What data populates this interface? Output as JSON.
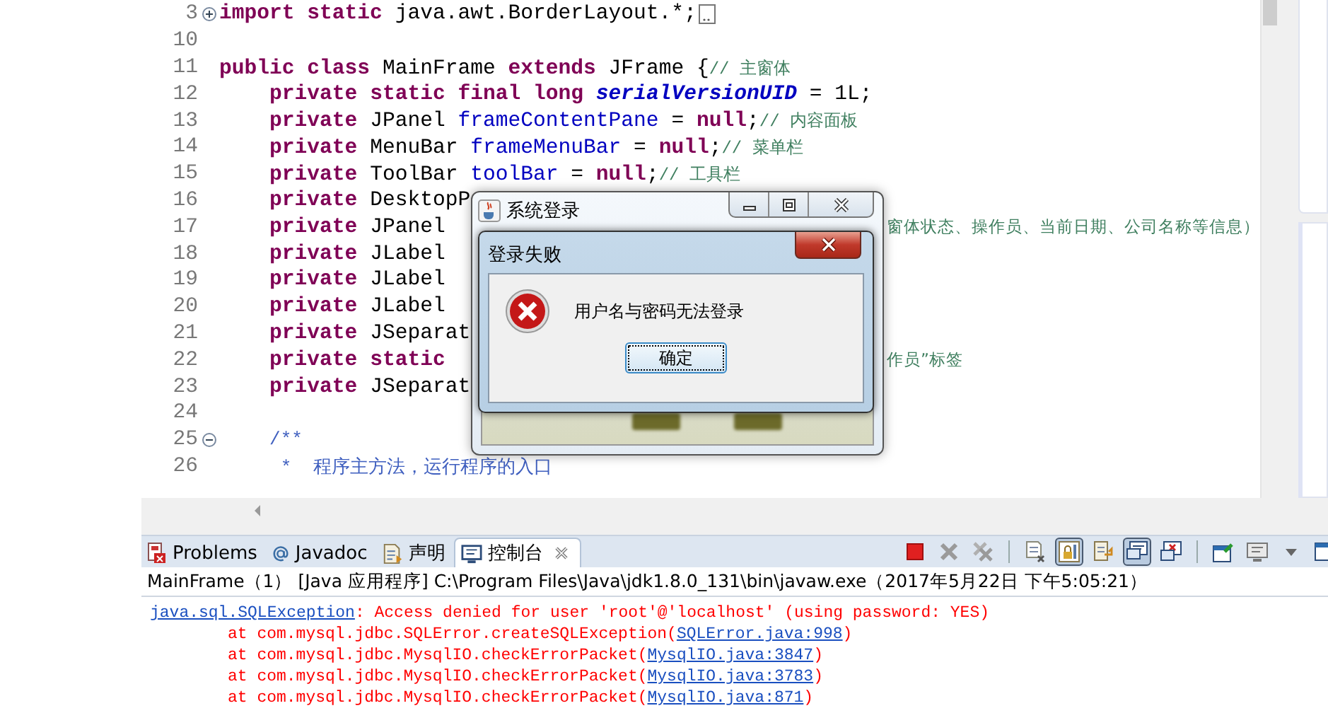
{
  "editor": {
    "lines": [
      {
        "number": "3",
        "kind": "top",
        "expanded": false,
        "folded_marker": true,
        "segments": [
          {
            "kind": "keyword",
            "text": "import"
          },
          {
            "kind": "keyword",
            "text": " static"
          },
          {
            "kind": "plain",
            "text": " java.awt.BorderLayout.*;"
          }
        ]
      },
      {
        "number": "10",
        "kind": "top"
      },
      {
        "number": "11",
        "kind": "top",
        "segments": [
          {
            "kind": "keyword",
            "text": "public"
          },
          {
            "kind": "keyword",
            "text": " class"
          },
          {
            "kind": "plain",
            "text": " MainFrame "
          },
          {
            "kind": "keyword",
            "text": "extends"
          },
          {
            "kind": "plain",
            "text": " JFrame {"
          },
          {
            "kind": "comment",
            "text": "// 主窗体"
          }
        ]
      },
      {
        "number": "12",
        "kind": "member",
        "segments": [
          {
            "kind": "keyword",
            "text": "private"
          },
          {
            "kind": "keyword",
            "text": " static"
          },
          {
            "kind": "keyword",
            "text": " final"
          },
          {
            "kind": "keyword",
            "text": " long"
          },
          {
            "kind": "static-field",
            "text": " serialVersionUID"
          },
          {
            "kind": "plain",
            "text": " = 1L;"
          }
        ]
      },
      {
        "number": "13",
        "kind": "member",
        "segments": [
          {
            "kind": "keyword",
            "text": "private"
          },
          {
            "kind": "plain",
            "text": " JPanel "
          },
          {
            "kind": "field",
            "text": "frameContentPane"
          },
          {
            "kind": "plain",
            "text": " = "
          },
          {
            "kind": "keyword",
            "text": "null"
          },
          {
            "kind": "plain",
            "text": ";"
          },
          {
            "kind": "comment",
            "text": "// 内容面板"
          }
        ]
      },
      {
        "number": "14",
        "kind": "member",
        "segments": [
          {
            "kind": "keyword",
            "text": "private"
          },
          {
            "kind": "plain",
            "text": " MenuBar "
          },
          {
            "kind": "field",
            "text": "frameMenuBar"
          },
          {
            "kind": "plain",
            "text": " = "
          },
          {
            "kind": "keyword",
            "text": "null"
          },
          {
            "kind": "plain",
            "text": ";"
          },
          {
            "kind": "comment",
            "text": "// 菜单栏"
          }
        ]
      },
      {
        "number": "15",
        "kind": "member",
        "segments": [
          {
            "kind": "keyword",
            "text": "private"
          },
          {
            "kind": "plain",
            "text": " ToolBar "
          },
          {
            "kind": "field",
            "text": "toolBar"
          },
          {
            "kind": "plain",
            "text": " = "
          },
          {
            "kind": "keyword",
            "text": "null"
          },
          {
            "kind": "plain",
            "text": ";"
          },
          {
            "kind": "comment",
            "text": "// 工具栏"
          }
        ]
      },
      {
        "number": "16",
        "kind": "member",
        "segments": [
          {
            "kind": "keyword",
            "text": "private"
          },
          {
            "kind": "plain",
            "text": " DesktopP"
          }
        ]
      },
      {
        "number": "17",
        "kind": "member",
        "segments": [
          {
            "kind": "keyword",
            "text": "private"
          },
          {
            "kind": "plain",
            "text": " JPanel"
          }
        ],
        "tail": "窗体状态、操作员、当前日期、公司名称等信息）"
      },
      {
        "number": "18",
        "kind": "member",
        "segments": [
          {
            "kind": "keyword",
            "text": "private"
          },
          {
            "kind": "plain",
            "text": " JLabel"
          }
        ]
      },
      {
        "number": "19",
        "kind": "member",
        "segments": [
          {
            "kind": "keyword",
            "text": "private"
          },
          {
            "kind": "plain",
            "text": " JLabel"
          }
        ]
      },
      {
        "number": "20",
        "kind": "member",
        "segments": [
          {
            "kind": "keyword",
            "text": "private"
          },
          {
            "kind": "plain",
            "text": " JLabel"
          }
        ]
      },
      {
        "number": "21",
        "kind": "member",
        "segments": [
          {
            "kind": "keyword",
            "text": "private"
          },
          {
            "kind": "plain",
            "text": " JSeparat"
          }
        ]
      },
      {
        "number": "22",
        "kind": "member",
        "segments": [
          {
            "kind": "keyword",
            "text": "private"
          },
          {
            "kind": "keyword",
            "text": " static"
          }
        ],
        "tail": "作员”标签"
      },
      {
        "number": "23",
        "kind": "member",
        "segments": [
          {
            "kind": "keyword",
            "text": "private"
          },
          {
            "kind": "plain",
            "text": " JSeparat"
          }
        ]
      },
      {
        "number": "24",
        "kind": "top"
      },
      {
        "number": "25",
        "kind": "member",
        "expanded": true,
        "segments": [
          {
            "kind": "javadoc",
            "text": "/**"
          }
        ]
      },
      {
        "number": "26",
        "kind": "member",
        "segments": [
          {
            "kind": "javadoc",
            "text": " *  程序主方法，运行程序的入口"
          }
        ]
      }
    ]
  },
  "login_window": {
    "title": "系统登录"
  },
  "error_dialog": {
    "title": "登录失败",
    "message": "用户名与密码无法登录",
    "button": "确定"
  },
  "console": {
    "tabs": [
      {
        "label": "Problems",
        "kind": "problems",
        "selected": false,
        "closable": false
      },
      {
        "label": "Javadoc",
        "kind": "javadoc",
        "selected": false,
        "closable": false
      },
      {
        "label": "声明",
        "kind": "declaration",
        "selected": false,
        "closable": false
      },
      {
        "label": "控制台",
        "kind": "console",
        "selected": true,
        "closable": true
      }
    ],
    "toolbar": [
      {
        "kind": "stop",
        "pressed": false
      },
      {
        "kind": "remove",
        "pressed": false
      },
      {
        "kind": "remove-all",
        "pressed": false
      },
      {
        "kind": "separator"
      },
      {
        "kind": "clear",
        "pressed": false
      },
      {
        "kind": "scroll-lock",
        "pressed": true
      },
      {
        "kind": "word-wrap",
        "pressed": false
      },
      {
        "kind": "show-stdout",
        "pressed": true
      },
      {
        "kind": "show-stderr",
        "pressed": false
      },
      {
        "kind": "separator"
      },
      {
        "kind": "pin",
        "pressed": false
      },
      {
        "kind": "display",
        "pressed": false
      },
      {
        "kind": "caret",
        "pressed": false
      },
      {
        "kind": "new-console",
        "pressed": false
      }
    ],
    "header": "MainFrame（1） [Java 应用程序] C:\\Program Files\\Java\\jdk1.8.0_131\\bin\\javaw.exe（2017年5月22日 下午5:05:21）",
    "lines": [
      {
        "kind": "exception",
        "segments": [
          {
            "kind": "link",
            "text": "java.sql.SQLException"
          },
          {
            "kind": "error",
            "text": ": Access denied for user 'root'@'localhost' (using password: YES)"
          }
        ]
      },
      {
        "kind": "frame",
        "segments": [
          {
            "kind": "error",
            "text": "at com.mysql.jdbc.SQLError.createSQLException("
          },
          {
            "kind": "link",
            "text": "SQLError.java:998"
          },
          {
            "kind": "error",
            "text": ")"
          }
        ]
      },
      {
        "kind": "frame",
        "segments": [
          {
            "kind": "error",
            "text": "at com.mysql.jdbc.MysqlIO.checkErrorPacket("
          },
          {
            "kind": "link",
            "text": "MysqlIO.java:3847"
          },
          {
            "kind": "error",
            "text": ")"
          }
        ]
      },
      {
        "kind": "frame",
        "segments": [
          {
            "kind": "error",
            "text": "at com.mysql.jdbc.MysqlIO.checkErrorPacket("
          },
          {
            "kind": "link",
            "text": "MysqlIO.java:3783"
          },
          {
            "kind": "error",
            "text": ")"
          }
        ]
      },
      {
        "kind": "frame",
        "segments": [
          {
            "kind": "error",
            "text": "at com.mysql.jdbc.MysqlIO.checkErrorPacket("
          },
          {
            "kind": "link",
            "text": "MysqlIO.java:871"
          },
          {
            "kind": "error",
            "text": ")"
          }
        ]
      }
    ]
  }
}
